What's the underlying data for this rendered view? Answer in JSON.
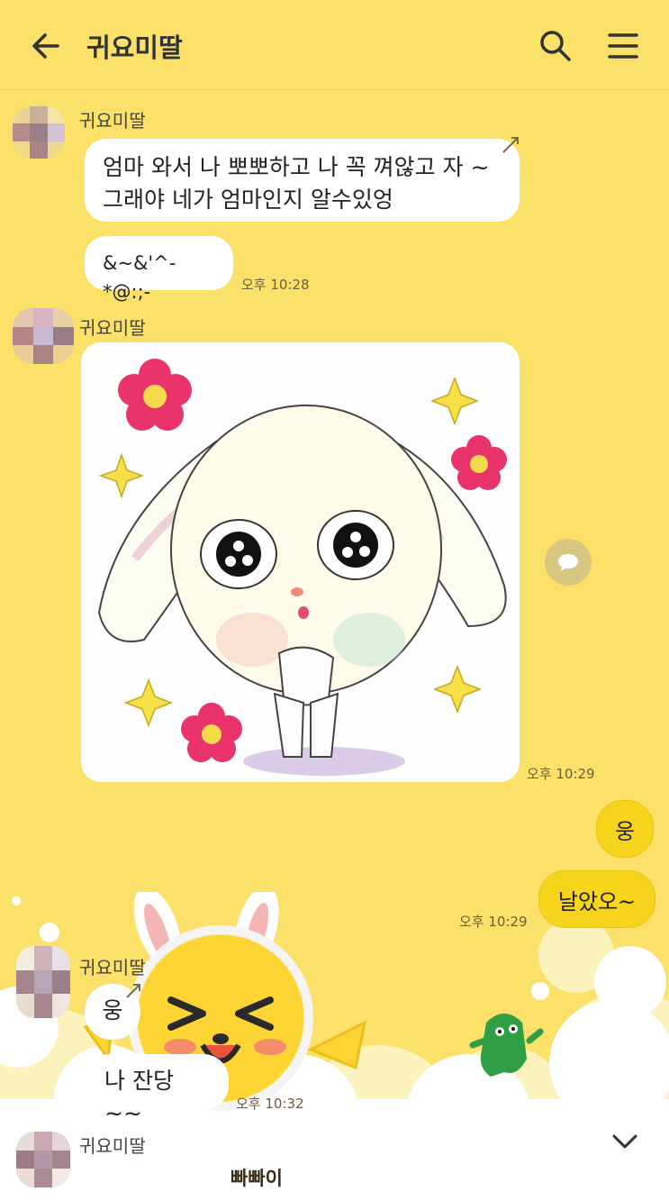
{
  "header": {
    "title": "귀요미딸",
    "back_icon": "arrow-left-icon",
    "search_icon": "search-icon",
    "menu_icon": "hamburger-menu-icon"
  },
  "messages": {
    "group1": {
      "sender": "귀요미딸",
      "line1": "엄마 와서 나 뽀뽀하고  나 꼭 껴않고 자 ~",
      "line2": "그래야 네가 엄마인지 알수있엉",
      "bubble2": "&~&'^-*@:;-",
      "time": "오후 10:28"
    },
    "group2": {
      "sender": "귀요미딸",
      "sticker": "crying-bunny-sticker",
      "time": "오후 10:29"
    },
    "outgoing": {
      "bubble1": "웅",
      "bubble2": "날았오~",
      "time": "오후 10:29"
    },
    "group3": {
      "sender": "귀요미딸",
      "bubble1": "웅",
      "bubble2": "나 잔당~~",
      "time": "오후 10:32"
    },
    "group4": {
      "sender": "귀요미딸",
      "label": "빠빠이"
    }
  },
  "colors": {
    "background": "#fbe06a",
    "incoming_bubble": "#ffffff",
    "outgoing_bubble": "#f7d41c"
  }
}
